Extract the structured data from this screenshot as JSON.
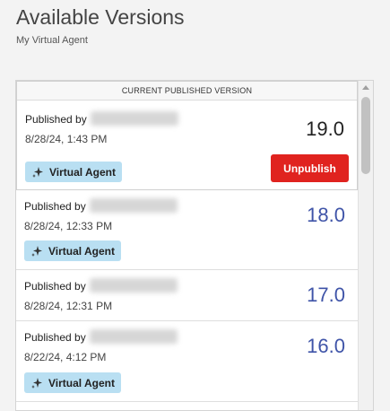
{
  "header": {
    "title": "Available Versions",
    "subtitle": "My Virtual Agent"
  },
  "current_label": "CURRENT PUBLISHED VERSION",
  "versions": [
    {
      "published_by_label": "Published by",
      "published_by_name": "[redacted]",
      "date": "8/28/24, 1:43 PM",
      "version": "19.0",
      "badge": "Virtual Agent",
      "action": "Unpublish",
      "is_current": true
    },
    {
      "published_by_label": "Published by",
      "published_by_name": "[redacted]",
      "date": "8/28/24, 12:33 PM",
      "version": "18.0",
      "badge": "Virtual Agent"
    },
    {
      "published_by_label": "Published by",
      "published_by_name": "[redacted]",
      "date": "8/28/24, 12:31 PM",
      "version": "17.0",
      "badge": ""
    },
    {
      "published_by_label": "Published by",
      "published_by_name": "[redacted]",
      "date": "8/22/24, 4:12 PM",
      "version": "16.0",
      "badge": "Virtual Agent"
    }
  ],
  "colors": {
    "unpublish": "#e0231f",
    "version_link": "#3f54a8",
    "badge_bg": "#b9dff2"
  },
  "icons": {
    "badge_icon": "sparkle-icon"
  }
}
